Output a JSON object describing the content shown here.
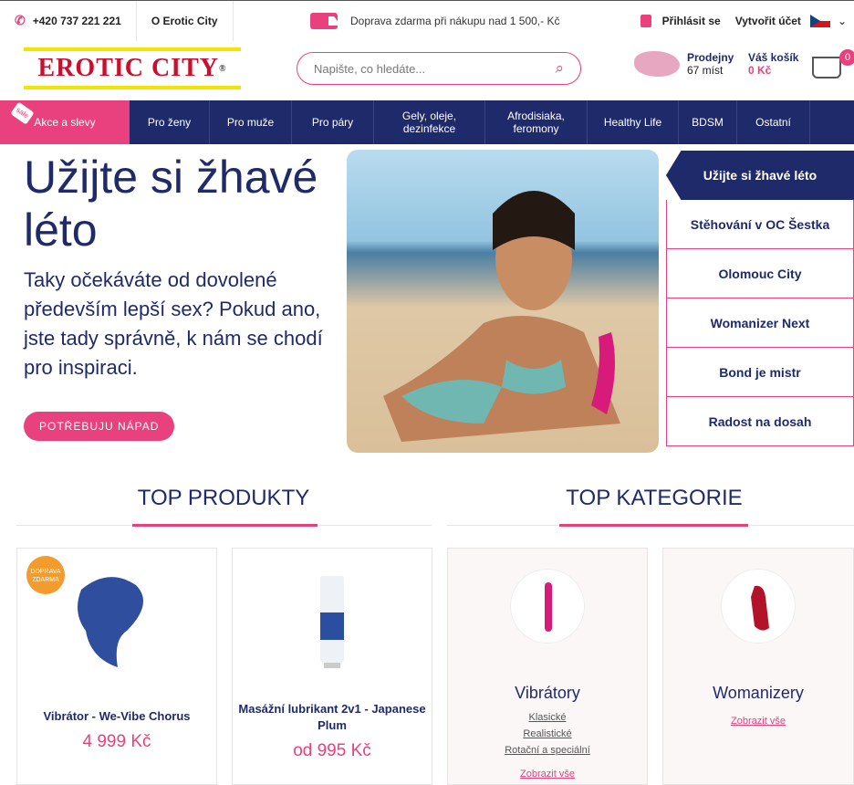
{
  "topbar": {
    "phone": "+420 737 221 221",
    "about": "O Erotic City",
    "shipping": "Doprava zdarma při nákupu nad 1 500,- Kč",
    "login": "Přihlásit se",
    "register": "Vytvořit účet",
    "lang_arrow": "⌄"
  },
  "header": {
    "logo": "EROTIC CITY",
    "logo_reg": "®",
    "search_placeholder": "Napište, co hledáte...",
    "stores_label": "Prodejny",
    "stores_count": "67 míst",
    "cart_label": "Váš košík",
    "cart_amount": "0 Kč",
    "cart_count": "0"
  },
  "nav": {
    "sale_tag": "sale",
    "items": [
      "Akce a slevy",
      "Pro ženy",
      "Pro muže",
      "Pro páry",
      "Gely, oleje, dezinfekce",
      "Afrodisiaka, feromony",
      "Healthy Life",
      "BDSM",
      "Ostatní"
    ]
  },
  "hero": {
    "title": "Užijte si žhavé léto",
    "text": "Taky očekáváte od dovolené především lepší sex? Pokud ano, jste tady správně, k nám se chodí pro inspiraci.",
    "button": "POTŘEBUJU NÁPAD"
  },
  "slides": [
    "Užijte si žhavé léto",
    "Stěhování v OC Šestka",
    "Olomouc City",
    "Womanizer Next",
    "Bond je mistr",
    "Radost na dosah"
  ],
  "sections": {
    "products": "TOP PRODUKTY",
    "categories": "TOP KATEGORIE"
  },
  "products": [
    {
      "badge": "DOPRAVA ZDARMA",
      "name": "Vibrátor - We-Vibe Chorus",
      "price": "4 999 Kč"
    },
    {
      "name": "Masážní lubrikant 2v1 - Japanese Plum",
      "price": "od 995 Kč"
    }
  ],
  "categories": [
    {
      "name": "Vibrátory",
      "links": [
        "Klasické",
        "Realistické",
        "Rotační a speciální"
      ],
      "all": "Zobrazit vše"
    },
    {
      "name": "Womanizery",
      "all": "Zobrazit vše"
    }
  ],
  "colors": {
    "brand_pink": "#e8417e",
    "navy": "#1f2a6b"
  }
}
